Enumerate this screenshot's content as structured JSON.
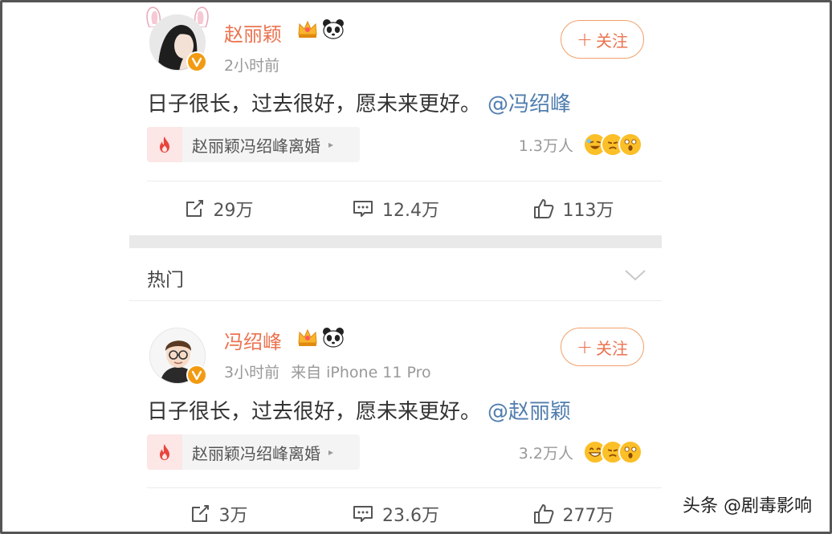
{
  "posts": [
    {
      "author": "赵丽颖",
      "time": "2小时前",
      "source": "",
      "follow_label": "关注",
      "text": "日子很长，过去很好，愿未来更好。",
      "mention": "@冯绍峰",
      "topic": "赵丽颖冯绍峰离婚",
      "reaction_count": "1.3万人",
      "reposts": "29万",
      "comments": "12.4万",
      "likes": "113万"
    },
    {
      "author": "冯绍峰",
      "time": "3小时前",
      "source": "来自 iPhone 11 Pro",
      "follow_label": "关注",
      "text": "日子很长，过去很好，愿未来更好。",
      "mention": "@赵丽颖",
      "topic": "赵丽颖冯绍峰离婚",
      "reaction_count": "3.2万人",
      "reposts": "3万",
      "comments": "23.6万",
      "likes": "277万"
    }
  ],
  "hot_section": {
    "title": "热门"
  },
  "watermark": "头条 @剧毒影响",
  "colors": {
    "accent": "#eb7350",
    "mention": "#507daf",
    "muted": "#999999",
    "badge": "#f29b12"
  },
  "icons": [
    "vip-badge-icon",
    "crown-icon",
    "panda-icon",
    "fire-icon",
    "repost-icon",
    "comment-icon",
    "like-icon",
    "chevron-down-icon"
  ]
}
